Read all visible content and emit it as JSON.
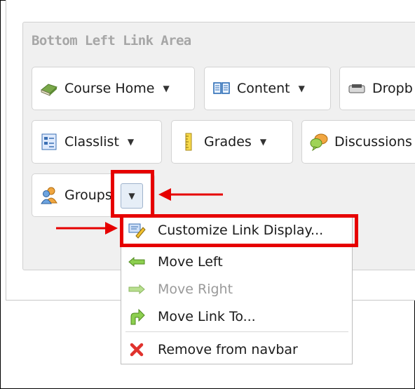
{
  "area": {
    "title": "Bottom Left Link Area"
  },
  "nav_links": [
    {
      "label": "Course Home",
      "icon": "book-icon"
    },
    {
      "label": "Content",
      "icon": "open-book-icon"
    },
    {
      "label": "Dropb",
      "icon": "dropbox-icon"
    },
    {
      "label": "Classlist",
      "icon": "classlist-icon"
    },
    {
      "label": "Grades",
      "icon": "ruler-icon"
    },
    {
      "label": "Discussions",
      "icon": "speech-bubbles-icon"
    },
    {
      "label": "Groups",
      "icon": "people-icon"
    }
  ],
  "menu": {
    "items": [
      {
        "label": "Customize Link Display...",
        "icon": "customize-icon",
        "enabled": true
      },
      {
        "label": "Move Left",
        "icon": "arrow-left-icon",
        "enabled": true
      },
      {
        "label": "Move Right",
        "icon": "arrow-right-icon",
        "enabled": false
      },
      {
        "label": "Move Link To...",
        "icon": "move-to-icon",
        "enabled": true
      },
      {
        "label": "Remove from navbar",
        "icon": "red-x-icon",
        "enabled": true
      }
    ]
  },
  "colors": {
    "highlight": "#e60000",
    "title_gray": "#a6a6a6"
  }
}
